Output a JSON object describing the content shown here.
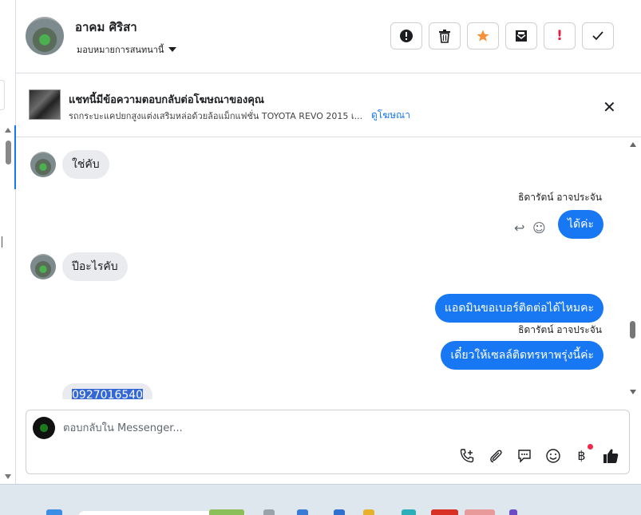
{
  "header": {
    "contact_name": "อาคม ศิริสา",
    "assign_label": "มอบหมายการสนทนานี้",
    "actions": [
      {
        "name": "report-button",
        "icon": "alert-icon",
        "glyph": "!"
      },
      {
        "name": "delete-button",
        "icon": "trash-icon",
        "glyph": "🗑"
      },
      {
        "name": "star-button",
        "icon": "star-icon",
        "glyph": "★"
      },
      {
        "name": "mark-unread-button",
        "icon": "envelope-icon",
        "glyph": "✉"
      },
      {
        "name": "important-button",
        "icon": "exclamation-icon",
        "glyph": "!"
      },
      {
        "name": "done-button",
        "icon": "check-icon",
        "glyph": "✓"
      }
    ]
  },
  "ad": {
    "title": "แชทนี้มีข้อความตอบกลับต่อโฆษณาของคุณ",
    "description": "รถกระบะแคปยกสูงแต่งเสริมหล่อด้วยล้อแม็กแฟชั่น TOYOTA REVO 2015 เ...",
    "link": "ดูโฆษณา"
  },
  "messages": {
    "m1": "ใช่คับ",
    "sender1": "ธิดารัตน์ อาจประจัน",
    "m2": "ได้ค่ะ",
    "m3": "ปีอะไรคับ",
    "m4": "แอดมินขอเบอร์ติดต่อได้ไหมคะ",
    "sender2": "ธิดารัตน์ อาจประจัน",
    "m5": "เดี๋ยวให้เซลล์ติดทรหาพรุ่งนี้ค่ะ",
    "m6": "0927016540"
  },
  "composer": {
    "placeholder": "ตอบกลับใน Messenger...",
    "tools": [
      {
        "name": "add-call-icon",
        "glyph": "📞"
      },
      {
        "name": "attach-icon",
        "glyph": "📎"
      },
      {
        "name": "saved-reply-icon",
        "glyph": "💬"
      },
      {
        "name": "emoji-icon",
        "glyph": "☺"
      },
      {
        "name": "baht-icon",
        "glyph": "฿"
      },
      {
        "name": "like-icon",
        "glyph": "👍"
      }
    ]
  },
  "colors": {
    "accent": "#1877f2",
    "star": "#f7923a",
    "important": "#e41e3f"
  }
}
